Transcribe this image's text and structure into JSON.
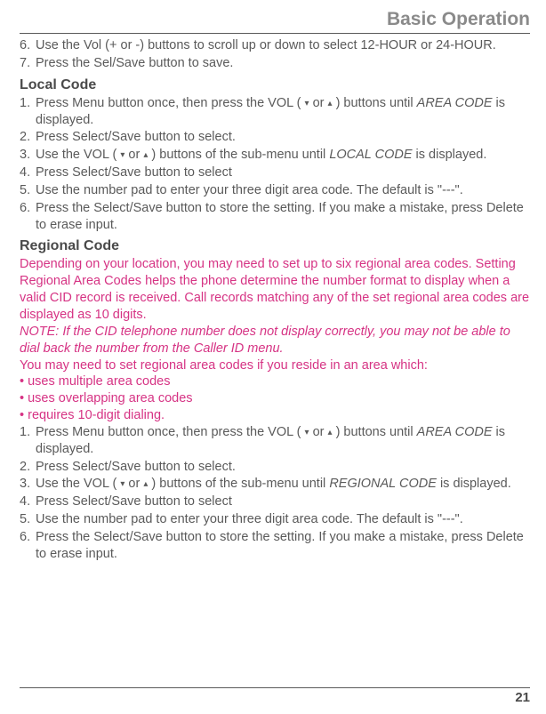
{
  "header": {
    "title": "Basic Operation"
  },
  "top_steps": [
    "Use the Vol (+ or -) buttons to scroll up or down to select 12-HOUR or 24-HOUR.",
    "Press the Sel/Save button to save."
  ],
  "local": {
    "title": "Local Code",
    "steps": [
      {
        "pre": "Press Menu button once, then press the VOL ( ",
        "mid": " or ",
        "post": " ) buttons until ",
        "ital": "AREA CODE",
        "tail": " is displayed."
      },
      {
        "pre": "Press Select/Save button to select."
      },
      {
        "pre": "Use the VOL ( ",
        "mid": " or ",
        "post": " ) buttons of the sub-menu until ",
        "ital": "LOCAL CODE",
        "tail": " is displayed."
      },
      {
        "pre": "Press Select/Save button to select"
      },
      {
        "pre": "Use the number pad to enter your three digit area code. The default is \"---\"."
      },
      {
        "pre": "Press the Select/Save button to store the setting. If you make a mistake, press Delete to erase input."
      }
    ]
  },
  "regional": {
    "title": "Regional Code",
    "intro": "Depending on your location, you may need to set up to six regional area codes. Setting Regional Area Codes helps the phone determine the number format to display when a valid CID record is received. Call records matching any of the set regional area codes are displayed as 10 digits.",
    "note": "NOTE: If the CID telephone number does not display correctly, you may not be able to dial back the number from the Caller ID menu.",
    "need": "You may need to set regional area codes if you reside in an area which:",
    "bullets": [
      "uses multiple area codes",
      "uses overlapping area codes",
      "requires 10-digit dialing."
    ],
    "steps": [
      {
        "pre": "Press Menu button once, then press the VOL ( ",
        "mid": " or ",
        "post": " ) buttons until ",
        "ital": "AREA CODE",
        "tail": " is displayed."
      },
      {
        "pre": "Press Select/Save button to select."
      },
      {
        "pre": "Use the VOL ( ",
        "mid": " or ",
        "post": " ) buttons of the sub-menu until ",
        "ital": "REGIONAL CODE",
        "tail": " is displayed."
      },
      {
        "pre": "Press Select/Save button to select"
      },
      {
        "pre": "Use the number pad to enter your three digit area code. The default is \"---\"."
      },
      {
        "pre": "Press the Select/Save button to store the setting. If you make a mistake, press Delete to erase input."
      }
    ]
  },
  "footer": {
    "page": "21"
  },
  "glyph": {
    "down": "▾",
    "up": "▴",
    "bullet": "•"
  }
}
